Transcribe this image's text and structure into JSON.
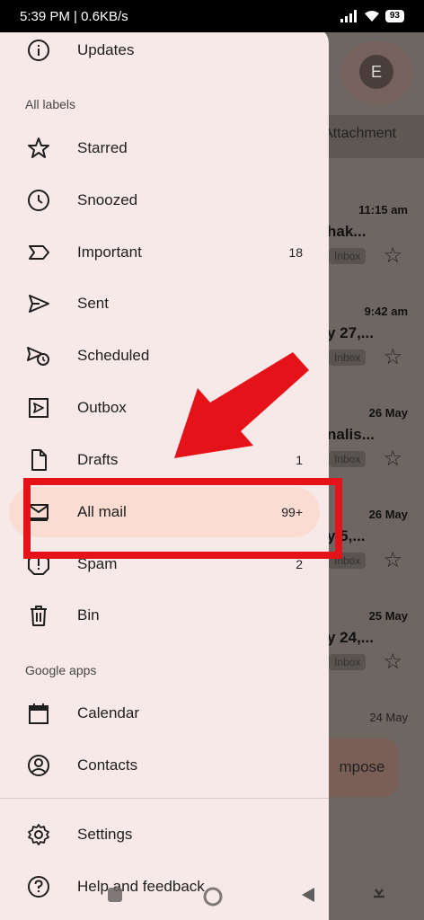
{
  "status_bar": {
    "time_speed": "5:39 PM | 0.6KB/s",
    "battery": "93"
  },
  "background": {
    "avatar_letter": "E",
    "attachment_tab": "Attachment",
    "compose_label": "mpose",
    "mails": [
      {
        "time": "11:15 am",
        "subject": "hak...",
        "badge": "Inbox"
      },
      {
        "time": "9:42 am",
        "subject": "y 27,...",
        "badge": "Inbox"
      },
      {
        "time": "26 May",
        "subject": "nalis...",
        "badge": "Inbox"
      },
      {
        "time": "26 May",
        "subject": "y 5,...",
        "badge": "Inbox"
      },
      {
        "time": "25 May",
        "subject": "y 24,...",
        "badge": "Inbox"
      },
      {
        "time": "24 May",
        "subject": "",
        "badge": ""
      }
    ]
  },
  "drawer": {
    "top_item": "Updates",
    "section_all_labels": "All labels",
    "items": [
      {
        "label": "Starred",
        "count": ""
      },
      {
        "label": "Snoozed",
        "count": ""
      },
      {
        "label": "Important",
        "count": "18"
      },
      {
        "label": "Sent",
        "count": ""
      },
      {
        "label": "Scheduled",
        "count": ""
      },
      {
        "label": "Outbox",
        "count": ""
      },
      {
        "label": "Drafts",
        "count": "1"
      },
      {
        "label": "All mail",
        "count": "99+"
      },
      {
        "label": "Spam",
        "count": "2"
      },
      {
        "label": "Bin",
        "count": ""
      }
    ],
    "section_google_apps": "Google apps",
    "apps": [
      {
        "label": "Calendar"
      },
      {
        "label": "Contacts"
      }
    ],
    "footer": [
      {
        "label": "Settings"
      },
      {
        "label": "Help and feedback"
      }
    ]
  },
  "colors": {
    "active_bg": "#fbdcd2",
    "drawer_bg": "#f7e9e7",
    "highlight_red": "#e6121a"
  }
}
